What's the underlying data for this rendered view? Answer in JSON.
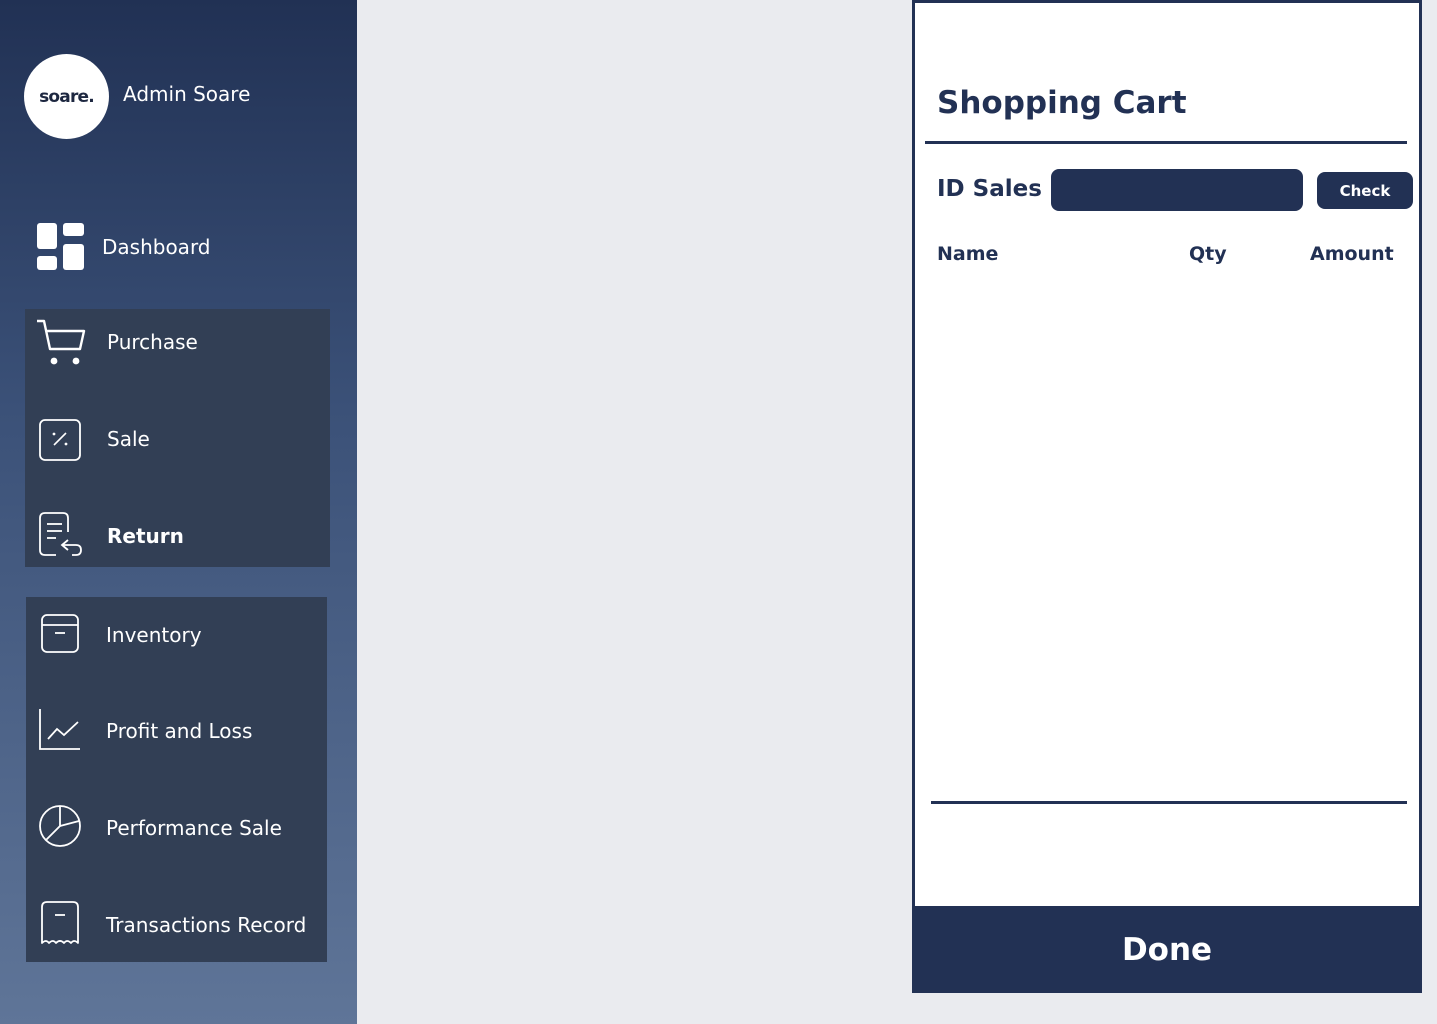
{
  "user": {
    "logo_text": "soare.",
    "name": "Admin Soare"
  },
  "nav": {
    "dashboard": "Dashboard",
    "group1": [
      {
        "label": "Purchase",
        "icon": "cart-icon",
        "active": false
      },
      {
        "label": "Sale",
        "icon": "sale-tag-icon",
        "active": false
      },
      {
        "label": "Return",
        "icon": "return-receipt-icon",
        "active": true
      }
    ],
    "group2": [
      {
        "label": "Inventory",
        "icon": "box-icon"
      },
      {
        "label": "Profit and Loss",
        "icon": "line-chart-icon"
      },
      {
        "label": "Performance Sale",
        "icon": "pie-chart-icon"
      },
      {
        "label": "Transactions Record",
        "icon": "receipt-icon"
      }
    ]
  },
  "cart": {
    "title": "Shopping Cart",
    "id_label": "ID Sales :",
    "id_value": "",
    "check_label": "Check",
    "columns": {
      "name": "Name",
      "qty": "Qty",
      "amount": "Amount"
    },
    "rows": [],
    "done_label": "Done"
  },
  "colors": {
    "primary": "#223154",
    "sidebar_group": "#323f55",
    "background": "#eaebef"
  }
}
